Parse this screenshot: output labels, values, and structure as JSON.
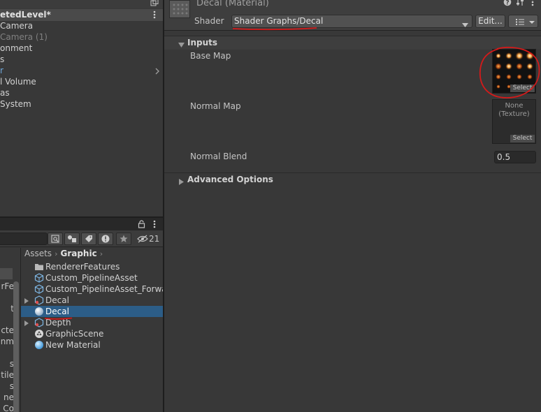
{
  "hierarchy": {
    "scene_title": "etedLevel*",
    "items": [
      {
        "label": "Camera",
        "dim": false
      },
      {
        "label": "Camera (1)",
        "dim": true
      },
      {
        "label": "onment",
        "dim": false
      },
      {
        "label": "s",
        "dim": false
      },
      {
        "label": "r",
        "dim": false
      },
      {
        "label": "l Volume",
        "dim": false
      },
      {
        "label": "as",
        "dim": false
      },
      {
        "label": "System",
        "dim": false
      }
    ]
  },
  "project": {
    "hidden_count": "21",
    "left_items": [
      "",
      "rFe",
      "t",
      "",
      "cte",
      "onm",
      "",
      "s",
      "tile",
      "s",
      "ne",
      "Co"
    ],
    "breadcrumb": {
      "root": "Assets",
      "current": "Graphic"
    },
    "assets": [
      {
        "label": "RendererFeatures",
        "icon": "folder-icon",
        "foldout": false,
        "selected": false
      },
      {
        "label": "Custom_PipelineAsset",
        "icon": "pipeline-asset-icon",
        "foldout": false,
        "selected": false
      },
      {
        "label": "Custom_PipelineAsset_Forwar",
        "icon": "pipeline-asset-icon",
        "foldout": false,
        "selected": false
      },
      {
        "label": "Decal",
        "icon": "shader-graph-icon",
        "foldout": true,
        "selected": false
      },
      {
        "label": "Decal",
        "icon": "material-icon",
        "foldout": false,
        "selected": true
      },
      {
        "label": "Depth",
        "icon": "shader-graph-icon",
        "foldout": true,
        "selected": false
      },
      {
        "label": "GraphicScene",
        "icon": "unity-scene-icon",
        "foldout": false,
        "selected": false
      },
      {
        "label": "New Material",
        "icon": "material-icon",
        "foldout": false,
        "selected": false
      }
    ]
  },
  "inspector": {
    "title": "Decal (Material)",
    "shader_label": "Shader",
    "shader_value": "Shader Graphs/Decal",
    "edit_label": "Edit...",
    "inputs_label": "Inputs",
    "base_map_label": "Base Map",
    "normal_map_label": "Normal Map",
    "normal_map_none": "None\n(Texture)",
    "select_label": "Select",
    "normal_blend_label": "Normal Blend",
    "normal_blend_value": "0.5",
    "advanced_label": "Advanced Options"
  },
  "colors": {
    "selection": "#2c5d87",
    "annotation_red": "#d41a1a",
    "panel_bg": "#383838"
  }
}
